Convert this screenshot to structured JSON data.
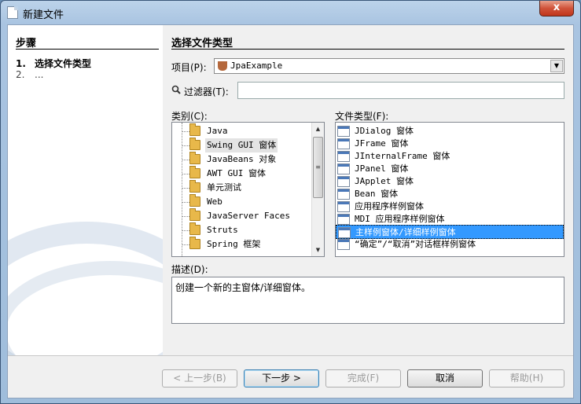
{
  "window": {
    "title": "新建文件",
    "close_label": "x"
  },
  "left_panel": {
    "heading": "步骤",
    "steps": [
      {
        "num": "1.",
        "label": "选择文件类型"
      },
      {
        "num": "2.",
        "label": "..."
      }
    ]
  },
  "main": {
    "heading": "选择文件类型",
    "project_label": "项目(P):",
    "project_value": "JpaExample",
    "filter_label": "过滤器(T):",
    "filter_value": "",
    "categories_label": "类别(C):",
    "categories": [
      "Java",
      "Swing GUI 窗体",
      "JavaBeans 对象",
      "AWT GUI 窗体",
      "单元测试",
      "Web",
      "JavaServer Faces",
      "Struts",
      "Spring 框架"
    ],
    "selected_category_index": 1,
    "file_types_label": "文件类型(F):",
    "file_types": [
      "JDialog 窗体",
      "JFrame 窗体",
      "JInternalFrame 窗体",
      "JPanel 窗体",
      "JApplet 窗体",
      "Bean 窗体",
      "应用程序样例窗体",
      "MDI 应用程序样例窗体",
      "主样例窗体/详细样例窗体",
      "“确定”/“取消”对话框样例窗体"
    ],
    "selected_file_type_index": 8,
    "description_label": "描述(D):",
    "description": "创建一个新的主窗体/详细窗体。"
  },
  "buttons": {
    "back": "< 上一步(B)",
    "next": "下一步 >",
    "finish": "完成(F)",
    "cancel": "取消",
    "help": "帮助(H)"
  }
}
